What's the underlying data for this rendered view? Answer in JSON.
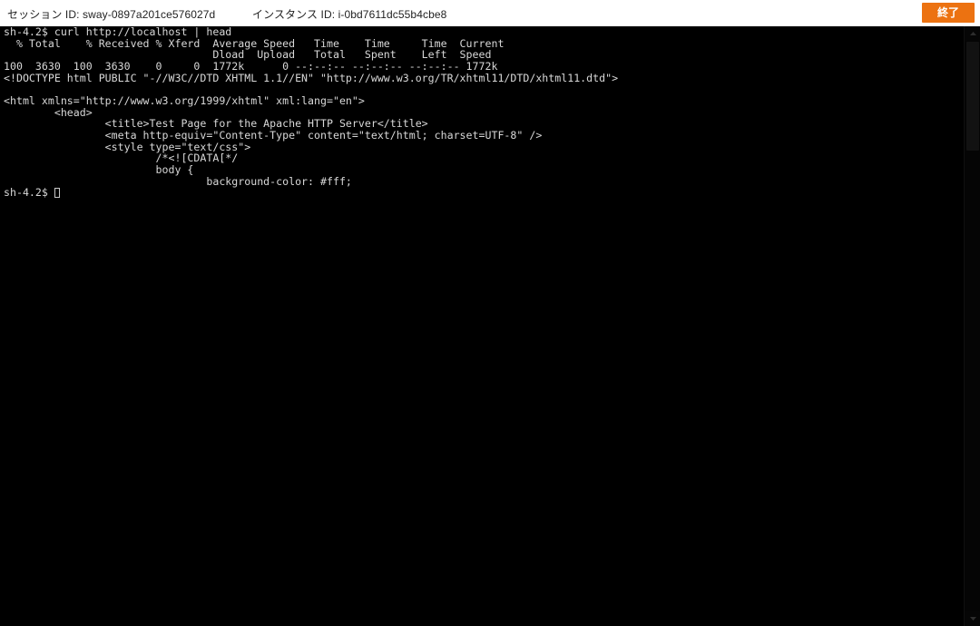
{
  "header": {
    "session_id_label": "セッション ID: sway-0897a201ce576027d",
    "instance_id_label": "インスタンス ID: i-0bd7611dc55b4cbe8",
    "end_button_label": "終了",
    "accent_color": "#ec7211",
    "background_color": "#ffffff"
  },
  "terminal": {
    "background_color": "#000000",
    "text_color": "#d8d8d8",
    "prompt": "sh-4.2$",
    "command": "curl http://localhost | head",
    "lines": [
      "sh-4.2$ curl http://localhost | head",
      "  % Total    % Received % Xferd  Average Speed   Time    Time     Time  Current",
      "                                 Dload  Upload   Total   Spent    Left  Speed",
      "100  3630  100  3630    0     0  1772k      0 --:--:-- --:--:-- --:--:-- 1772k",
      "<!DOCTYPE html PUBLIC \"-//W3C//DTD XHTML 1.1//EN\" \"http://www.w3.org/TR/xhtml11/DTD/xhtml11.dtd\">",
      "",
      "<html xmlns=\"http://www.w3.org/1999/xhtml\" xml:lang=\"en\">",
      "        <head>",
      "                <title>Test Page for the Apache HTTP Server</title>",
      "                <meta http-equiv=\"Content-Type\" content=\"text/html; charset=UTF-8\" />",
      "                <style type=\"text/css\">",
      "                        /*<![CDATA[*/",
      "                        body {",
      "                                background-color: #fff;"
    ],
    "final_prompt": "sh-4.2$"
  },
  "scrollbar": {
    "up_arrow_icon": "chevron-up-icon",
    "down_arrow_icon": "chevron-down-icon"
  }
}
